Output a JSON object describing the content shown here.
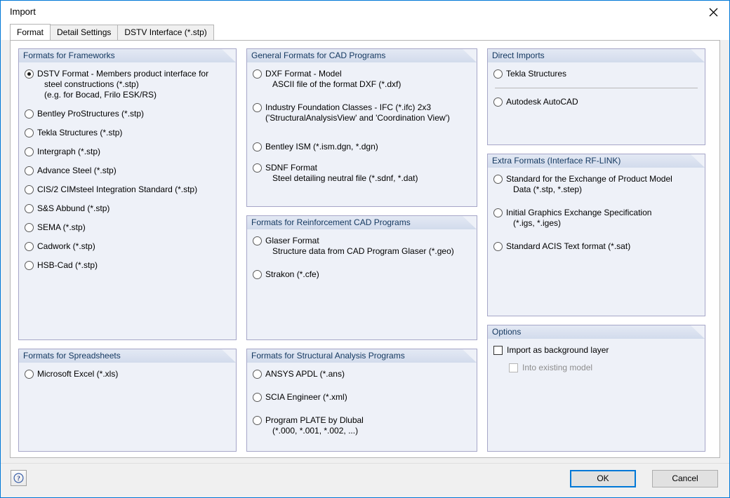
{
  "window": {
    "title": "Import",
    "close_icon": "close-icon"
  },
  "tabs": [
    {
      "label": "Format",
      "active": true
    },
    {
      "label": "Detail Settings",
      "active": false
    },
    {
      "label": "DSTV Interface (*.stp)",
      "active": false
    }
  ],
  "groups": {
    "frameworks": {
      "title": "Formats for Frameworks",
      "options": [
        {
          "lines": [
            "DSTV Format - Members product interface for",
            "steel constructions (*.stp)",
            "(e.g. for Bocad, Frilo ESK/RS)"
          ],
          "checked": true
        },
        {
          "lines": [
            "Bentley ProStructures (*.stp)"
          ],
          "checked": false
        },
        {
          "lines": [
            "Tekla Structures (*.stp)"
          ],
          "checked": false
        },
        {
          "lines": [
            "Intergraph (*.stp)"
          ],
          "checked": false
        },
        {
          "lines": [
            "Advance Steel (*.stp)"
          ],
          "checked": false
        },
        {
          "lines": [
            "CIS/2 CIMsteel Integration Standard (*.stp)"
          ],
          "checked": false
        },
        {
          "lines": [
            "S&S Abbund (*.stp)"
          ],
          "checked": false
        },
        {
          "lines": [
            "SEMA (*.stp)"
          ],
          "checked": false
        },
        {
          "lines": [
            "Cadwork (*.stp)"
          ],
          "checked": false
        },
        {
          "lines": [
            "HSB-Cad (*.stp)"
          ],
          "checked": false
        }
      ]
    },
    "spreadsheets": {
      "title": "Formats for Spreadsheets",
      "options": [
        {
          "lines": [
            "Microsoft Excel (*.xls)"
          ],
          "checked": false
        }
      ]
    },
    "cad": {
      "title": "General Formats for CAD Programs",
      "options": [
        {
          "lines": [
            "DXF Format - Model",
            "ASCII file of the format DXF (*.dxf)"
          ],
          "checked": false
        },
        {
          "lines": [
            "Industry Foundation Classes - IFC (*.ifc) 2x3",
            "('StructuralAnalysisView' and 'Coordination View')"
          ],
          "checked": false
        },
        {
          "lines": [
            "Bentley ISM (*.ism.dgn, *.dgn)"
          ],
          "checked": false
        },
        {
          "lines": [
            "SDNF Format",
            "Steel detailing neutral file (*.sdnf, *.dat)"
          ],
          "checked": false
        }
      ]
    },
    "reinforcement": {
      "title": "Formats for Reinforcement CAD Programs",
      "options": [
        {
          "lines": [
            "Glaser Format",
            "Structure data from CAD Program Glaser (*.geo)"
          ],
          "checked": false
        },
        {
          "lines": [
            "Strakon (*.cfe)"
          ],
          "checked": false
        }
      ]
    },
    "structural": {
      "title": "Formats for Structural Analysis Programs",
      "options": [
        {
          "lines": [
            "ANSYS APDL (*.ans)"
          ],
          "checked": false
        },
        {
          "lines": [
            "SCIA Engineer (*.xml)"
          ],
          "checked": false
        },
        {
          "lines": [
            "Program PLATE by Dlubal",
            "(*.000, *.001, *.002, ...)"
          ],
          "checked": false
        }
      ]
    },
    "direct_imports": {
      "title": "Direct Imports",
      "options": [
        {
          "lines": [
            "Tekla Structures"
          ],
          "checked": false
        },
        {
          "lines": [
            "Autodesk AutoCAD"
          ],
          "checked": false
        }
      ]
    },
    "extra_formats": {
      "title": "Extra Formats (Interface RF-LINK)",
      "options": [
        {
          "lines": [
            "Standard for the Exchange of Product Model",
            "Data (*.stp, *.step)"
          ],
          "checked": false
        },
        {
          "lines": [
            "Initial Graphics Exchange Specification",
            "(*.igs, *.iges)"
          ],
          "checked": false
        },
        {
          "lines": [
            "Standard ACIS Text format (*.sat)"
          ],
          "checked": false
        }
      ]
    },
    "options": {
      "title": "Options",
      "checkboxes": [
        {
          "label": "Import as background layer",
          "checked": false,
          "disabled": false
        },
        {
          "label": "Into existing model",
          "checked": false,
          "disabled": true
        }
      ]
    }
  },
  "footer": {
    "help_icon": "help-icon",
    "ok_label": "OK",
    "cancel_label": "Cancel"
  },
  "colors": {
    "accent": "#0078d7",
    "group_border": "#a6a6c8",
    "group_bg": "#eef1f8",
    "group_header_text": "#12375f",
    "disabled_text": "#8d8d8d"
  }
}
